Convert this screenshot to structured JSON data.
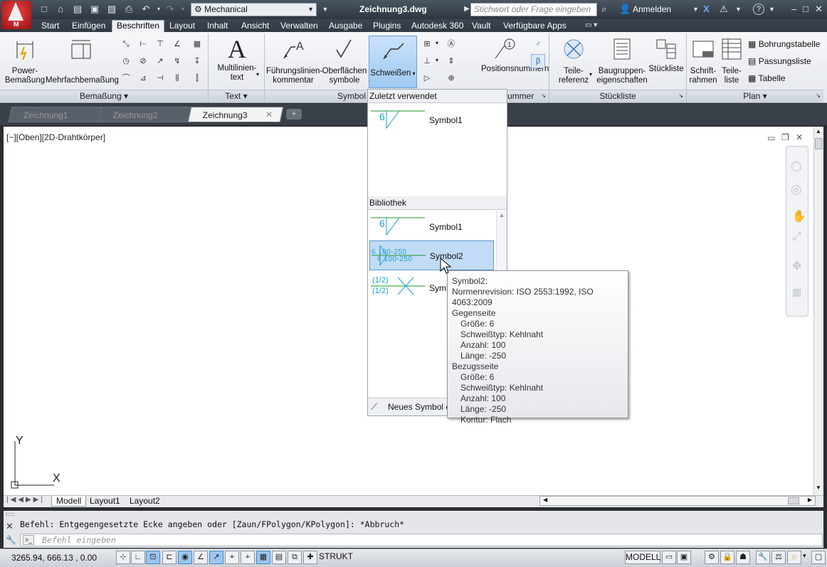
{
  "app": {
    "logo_letter": "M"
  },
  "titlebar": {
    "workspace": "Mechanical",
    "document_title": "Zeichnung3.dwg",
    "search_placeholder": "Stichwort oder Frage eingeben",
    "signin_label": "Anmelden"
  },
  "ribbon_tabs": [
    "Start",
    "Einfügen",
    "Beschriften",
    "Layout",
    "Inhalt",
    "Ansicht",
    "Verwalten",
    "Ausgabe",
    "Plugins",
    "Autodesk 360",
    "Vault",
    "Verfügbare Apps"
  ],
  "active_ribbon_tab": "Beschriften",
  "panels": {
    "bemassung": {
      "title": "Bemaßung",
      "power_label": "Power-\nBemaßung",
      "multi_label": "Mehrfachbemaßung"
    },
    "text": {
      "title": "Text",
      "multiline_label": "Multilinien-\ntext"
    },
    "symbol": {
      "title": "Symbol",
      "leader_label": "Führungslinien-\nkommentar",
      "surface_label": "Oberflächen\nsymbole",
      "weld_label": "Schweißen"
    },
    "nummer": {
      "title": "ummer",
      "position_label": "Positionsnummern"
    },
    "stueckliste": {
      "title": "Stückliste",
      "teile_label": "Teile-\nreferenz",
      "baugruppen_label": "Baugruppen-\neigenschaften",
      "stueck_label": "Stückliste"
    },
    "plan": {
      "title": "Plan",
      "schrift_label": "Schrift-\nrahmen",
      "teileliste_label": "Teile-\nliste",
      "bohrung_label": "Bohrungstabelle",
      "passung_label": "Passungsliste",
      "tabelle_label": "Tabelle"
    }
  },
  "doc_tabs": [
    "Zeichnung1",
    "Zeichnung2",
    "Zeichnung3"
  ],
  "active_doc_tab": "Zeichnung3",
  "viewport_label": "[−][Oben][2D-Drahtkörper]",
  "axes": {
    "x": "X",
    "y": "Y"
  },
  "layout_tabs": [
    "Modell",
    "Layout1",
    "Layout2"
  ],
  "command": {
    "history": "Befehl: Entgegengesetzte Ecke angeben oder [Zaun/FPolygon/KPolygon]: *Abbruch*",
    "input_placeholder": "Befehl eingeben"
  },
  "status": {
    "coords": "3265.94, 666.13 , 0.00",
    "strukt": "STRUKT",
    "modell": "MODELL"
  },
  "gallery": {
    "recent_header": "Zuletzt verwendet",
    "library_header": "Bibliothek",
    "recent_items": [
      {
        "label": "Symbol1",
        "sample": "6"
      }
    ],
    "library_items": [
      {
        "label": "Symbol1",
        "sample": "6"
      },
      {
        "label": "Symbol2",
        "sample_top": "6  100-250",
        "sample_bottom": "6  100-250"
      },
      {
        "label": "Symbol3",
        "sample_top": "(1/2)",
        "sample_bottom": "(1/2)"
      }
    ],
    "new_symbol_label": "Neues Symbol e"
  },
  "tooltip": {
    "title": "Symbol2:",
    "norm": "Normenrevision: ISO 2553:1992, ISO 4063:2009",
    "other_side": "Gegenseite",
    "other": [
      "Größe: 6",
      "Schweißtyp: Kehlnaht",
      "Anzahl: 100",
      "Länge: -250"
    ],
    "ref_side": "Bezugsseite",
    "ref": [
      "Größe: 6",
      "Schweißtyp: Kehlnaht",
      "Anzahl: 100",
      "Länge: -250",
      "Kontur: Flach"
    ]
  }
}
